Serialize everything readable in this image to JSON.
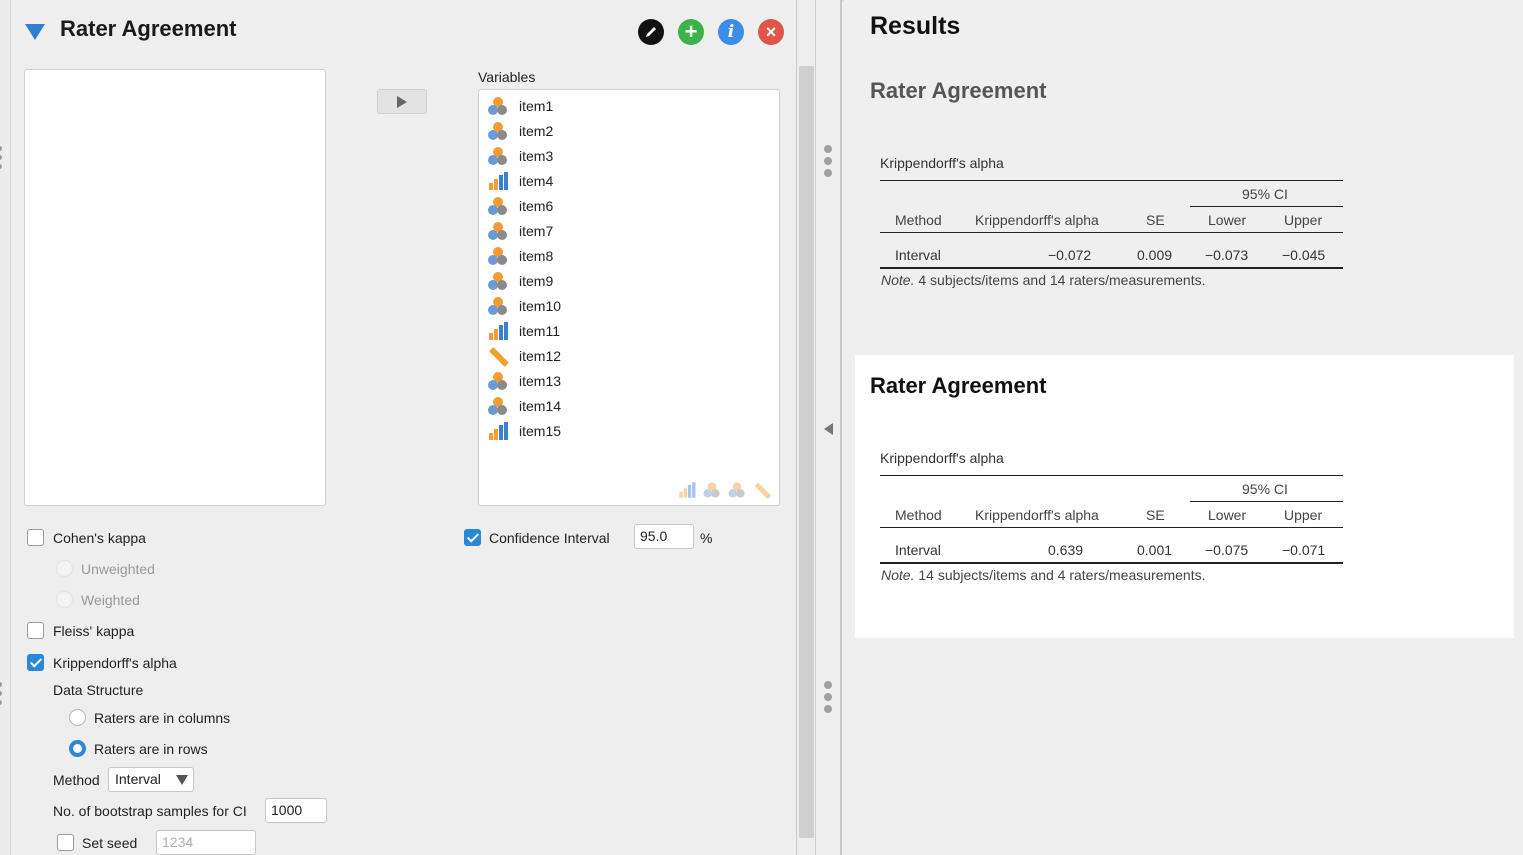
{
  "panel": {
    "title": "Rater Agreement",
    "header_buttons": {
      "edit": "pencil-icon",
      "add": "+",
      "info": "i",
      "close": "×"
    }
  },
  "variables": {
    "label": "Variables",
    "items": [
      {
        "name": "item1",
        "type": "nominal"
      },
      {
        "name": "item2",
        "type": "nominal"
      },
      {
        "name": "item3",
        "type": "nominal"
      },
      {
        "name": "item4",
        "type": "ordinal"
      },
      {
        "name": "item6",
        "type": "nominal"
      },
      {
        "name": "item7",
        "type": "nominal"
      },
      {
        "name": "item8",
        "type": "nominal"
      },
      {
        "name": "item9",
        "type": "nominal"
      },
      {
        "name": "item10",
        "type": "nominal"
      },
      {
        "name": "item11",
        "type": "ordinal"
      },
      {
        "name": "item12",
        "type": "scale"
      },
      {
        "name": "item13",
        "type": "nominal"
      },
      {
        "name": "item14",
        "type": "nominal"
      },
      {
        "name": "item15",
        "type": "ordinal"
      }
    ]
  },
  "options": {
    "cohens_kappa": {
      "label": "Cohen's kappa",
      "checked": false
    },
    "unweighted": "Unweighted",
    "weighted": "Weighted",
    "fleiss_kappa": {
      "label": "Fleiss' kappa",
      "checked": false
    },
    "krippendorff": {
      "label": "Krippendorff's alpha",
      "checked": true
    },
    "data_structure": "Data Structure",
    "raters_columns": "Raters are in columns",
    "raters_rows": "Raters are in rows",
    "method_label": "Method",
    "method_value": "Interval",
    "bootstrap_label": "No. of bootstrap samples for CI",
    "bootstrap_value": "1000",
    "set_seed": "Set seed",
    "seed_placeholder": "1234",
    "confidence_interval": {
      "label": "Confidence Interval",
      "checked": true,
      "value": "95.0",
      "unit": "%"
    }
  },
  "results": {
    "title": "Results",
    "blocks": [
      {
        "heading": "Rater Agreement",
        "caption": "Krippendorff's alpha",
        "ci_header": "95% CI",
        "columns": [
          "Method",
          "Krippendorff's alpha",
          "SE",
          "Lower",
          "Upper"
        ],
        "row": [
          "Interval",
          "−0.072",
          "0.009",
          "−0.073",
          "−0.045"
        ],
        "note_label": "Note.",
        "note_text": " 4 subjects/items and 14 raters/measurements."
      },
      {
        "heading": "Rater Agreement",
        "caption": "Krippendorff's alpha",
        "ci_header": "95% CI",
        "columns": [
          "Method",
          "Krippendorff's alpha",
          "SE",
          "Lower",
          "Upper"
        ],
        "row": [
          "Interval",
          "0.639",
          "0.001",
          "−0.075",
          "−0.071"
        ],
        "note_label": "Note.",
        "note_text": " 14 subjects/items and 4 raters/measurements."
      }
    ]
  },
  "colors": {
    "accent": "#2a88d8",
    "nominal_orange": "#f39c34",
    "nominal_blue": "#6b9bd6",
    "add_green": "#3bb34a",
    "close_red": "#e0554a"
  }
}
